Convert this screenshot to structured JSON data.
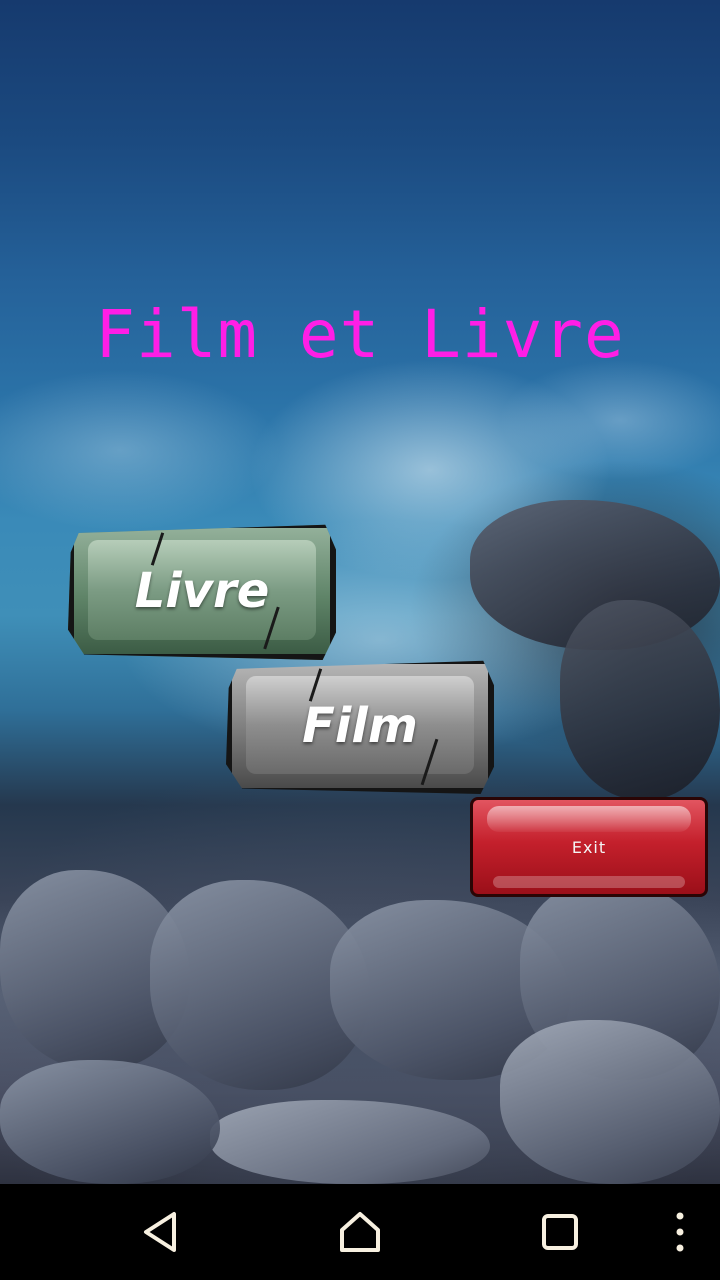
{
  "title": "Film et Livre",
  "buttons": {
    "livre_label": "Livre",
    "film_label": "Film",
    "exit_label": "Exit"
  },
  "colors": {
    "title": "#ff1ee6",
    "exit": "#c4202c",
    "livre": "#587a60",
    "film": "#7b7b7b"
  },
  "navbar": {
    "back_icon": "back-triangle-icon",
    "home_icon": "home-icon",
    "recents_icon": "recents-square-icon",
    "menu_icon": "overflow-menu-icon"
  }
}
